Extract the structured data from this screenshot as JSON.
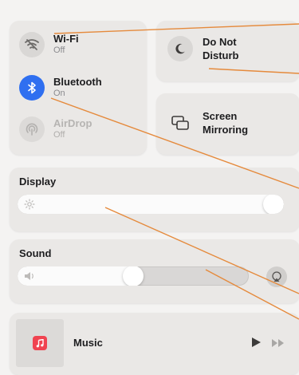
{
  "connectivity": {
    "wifi": {
      "label": "Wi-Fi",
      "status": "Off",
      "icon": "wifi-off-icon"
    },
    "bluetooth": {
      "label": "Bluetooth",
      "status": "On",
      "icon": "bluetooth-icon"
    },
    "airdrop": {
      "label": "AirDrop",
      "status": "Off",
      "icon": "airdrop-icon"
    }
  },
  "do_not_disturb": {
    "label_line1": "Do Not",
    "label_line2": "Disturb",
    "icon": "moon-icon"
  },
  "screen_mirroring": {
    "label_line1": "Screen",
    "label_line2": "Mirroring",
    "icon": "screen-mirroring-icon"
  },
  "display": {
    "title": "Display",
    "level": 1.0
  },
  "sound": {
    "title": "Sound",
    "level": 0.5
  },
  "now_playing": {
    "app": "Music",
    "icon": "music-app-icon"
  },
  "colors": {
    "accent": "#2f6ff0",
    "tile_background": "#eae8e6",
    "annotation_line": "#e58a3c",
    "music_icon": "#f04350"
  }
}
